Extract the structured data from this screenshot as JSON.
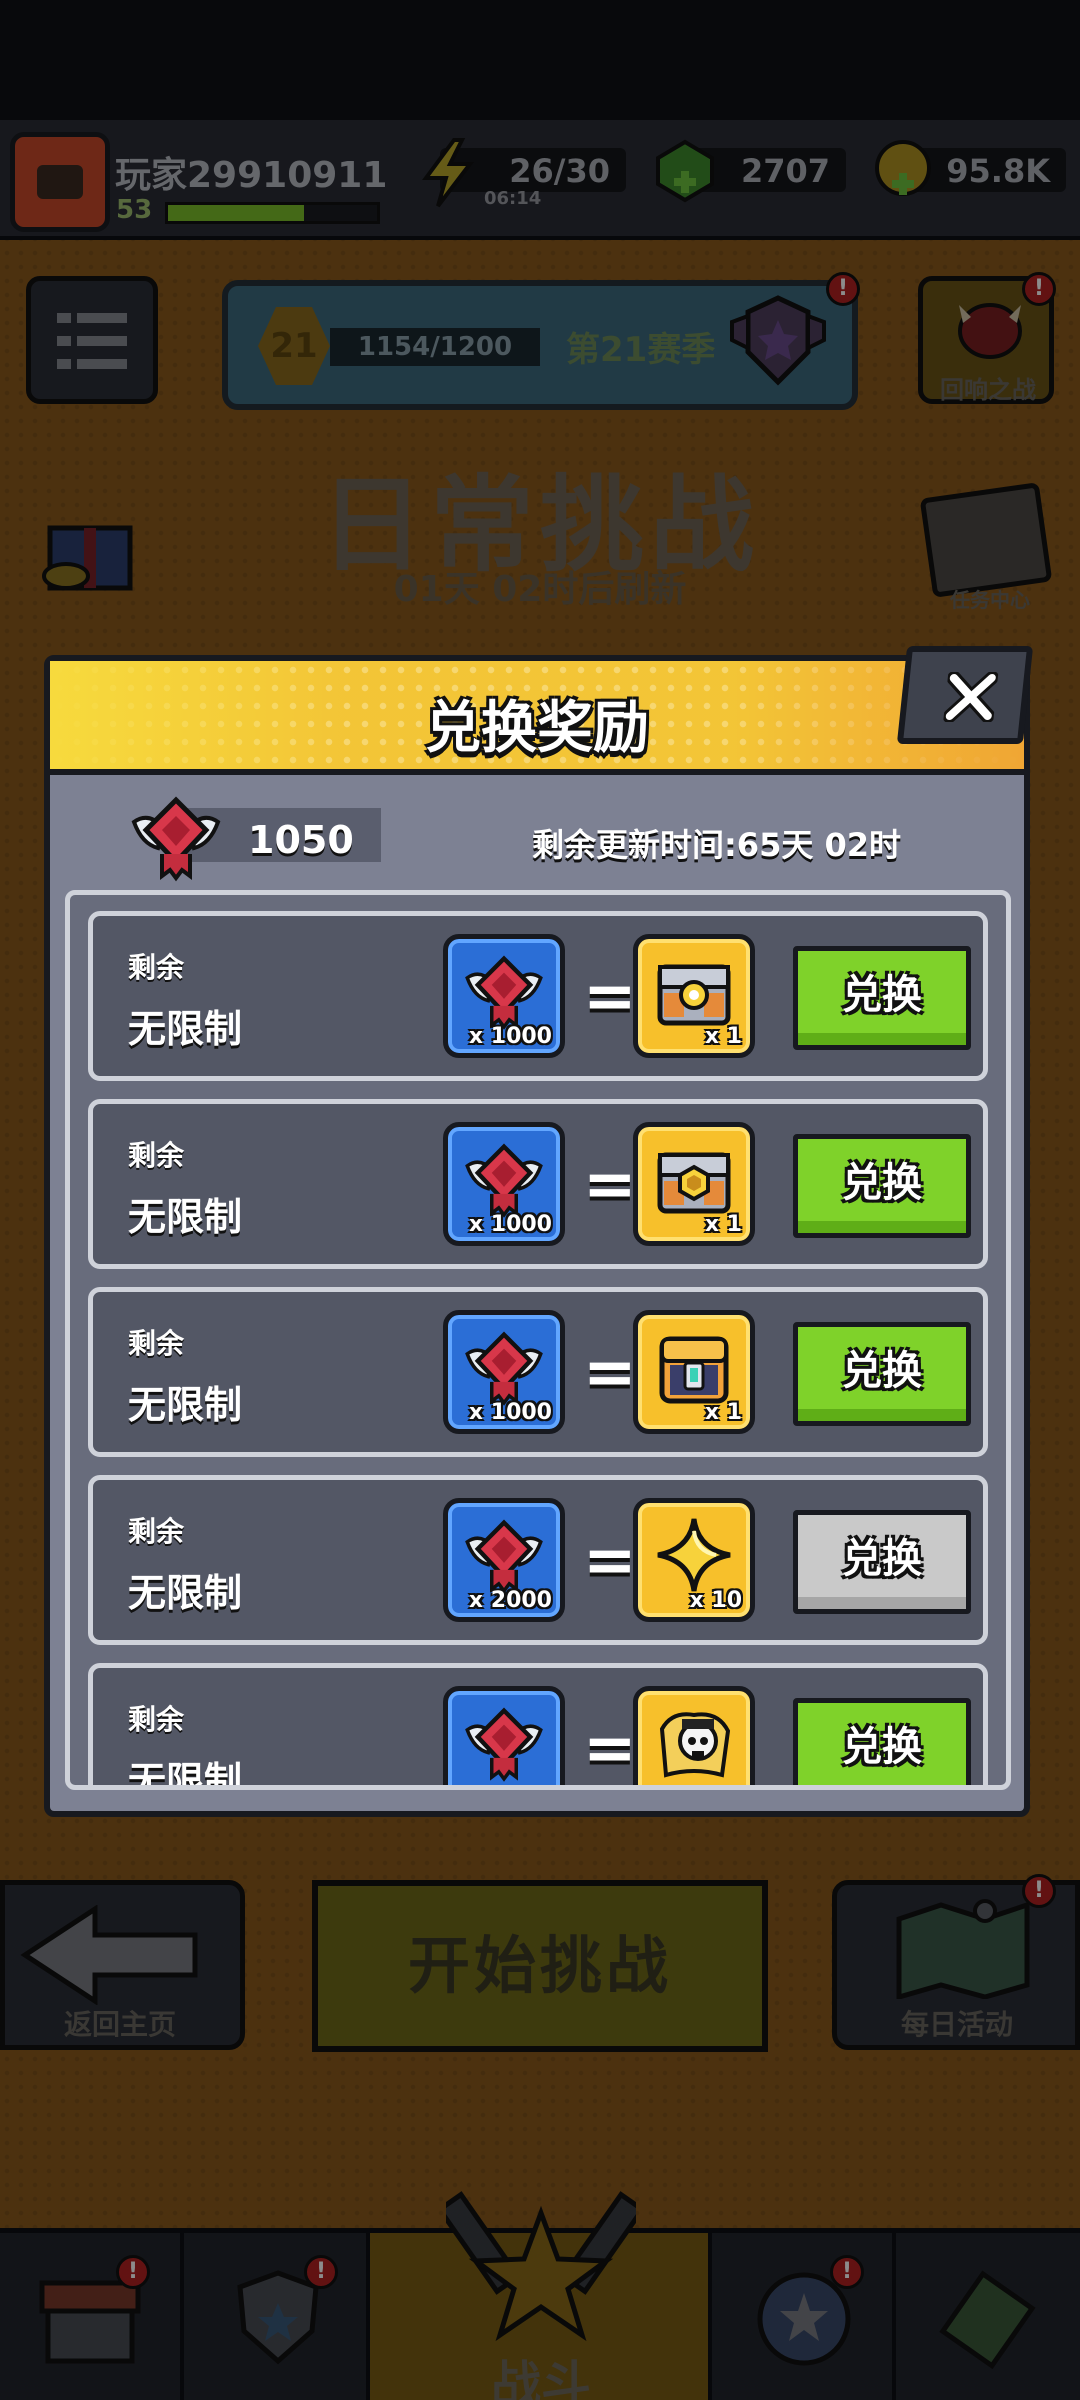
{
  "top_bar": {
    "player_name": "玩家29910911",
    "player_level": "53",
    "xp_progress": 0.65,
    "energy": "26/30",
    "energy_timer": "06:14",
    "gems": "2707",
    "coins": "95.8K"
  },
  "season": {
    "level": "21",
    "progress_text": "1154/1200",
    "name": "第21赛季"
  },
  "side_buttons": {
    "echo_battle_label": "回响之战",
    "task_center_label": "任务中心"
  },
  "scene": {
    "title": "日常挑战",
    "refresh_text": "01天 02时后刷新",
    "back_label": "返回主页",
    "start_label": "开始挑战",
    "daily_label": "每日活动",
    "battle_tab_label": "战斗"
  },
  "modal": {
    "title": "兑换奖励",
    "currency_amount": "1050",
    "refresh_timer": "剩余更新时间:65天 02时",
    "rows": [
      {
        "remain_label": "剩余",
        "limit_label": "无限制",
        "cost": "x 1000",
        "reward_icon": "silver-chest-icon",
        "reward_count": "x 1",
        "button_label": "兑换",
        "enabled": true
      },
      {
        "remain_label": "剩余",
        "limit_label": "无限制",
        "cost": "x 1000",
        "reward_icon": "hex-chest-icon",
        "reward_count": "x 1",
        "button_label": "兑换",
        "enabled": true
      },
      {
        "remain_label": "剩余",
        "limit_label": "无限制",
        "cost": "x 1000",
        "reward_icon": "gold-chest-icon",
        "reward_count": "x 1",
        "button_label": "兑换",
        "enabled": true
      },
      {
        "remain_label": "剩余",
        "limit_label": "无限制",
        "cost": "x 2000",
        "reward_icon": "star-shard-icon",
        "reward_count": "x 10",
        "button_label": "兑换",
        "enabled": false
      },
      {
        "remain_label": "剩余",
        "limit_label": "无限制",
        "cost": "",
        "reward_icon": "skull-map-icon",
        "reward_count": "",
        "button_label": "兑换",
        "enabled": true
      }
    ]
  },
  "colors": {
    "exchange_green": "#7fd22a",
    "disabled_gray": "#c9c9c9",
    "header_yellow": "#f2c035",
    "cost_blue": "#2b6ed6",
    "reward_gold": "#f7c02b"
  }
}
